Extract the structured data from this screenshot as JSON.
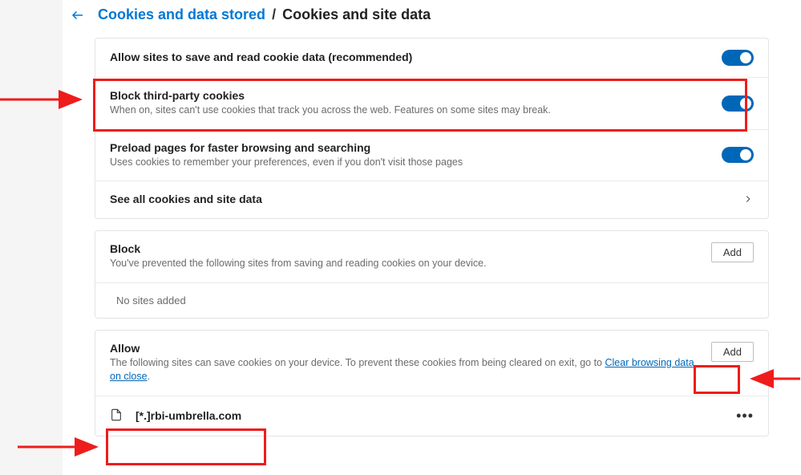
{
  "breadcrumb": {
    "link": "Cookies and data stored",
    "sep": "/",
    "current": "Cookies and site data"
  },
  "settings": {
    "allow_save": {
      "title": "Allow sites to save and read cookie data (recommended)"
    },
    "block_third": {
      "title": "Block third-party cookies",
      "desc": "When on, sites can't use cookies that track you across the web. Features on some sites may break."
    },
    "preload": {
      "title": "Preload pages for faster browsing and searching",
      "desc": "Uses cookies to remember your preferences, even if you don't visit those pages"
    },
    "see_all": {
      "title": "See all cookies and site data"
    }
  },
  "block_section": {
    "title": "Block",
    "desc": "You've prevented the following sites from saving and reading cookies on your device.",
    "add": "Add",
    "empty": "No sites added"
  },
  "allow_section": {
    "title": "Allow",
    "desc_pre": "The following sites can save cookies on your device. To prevent these cookies from being cleared on exit, go to ",
    "desc_link": "Clear browsing data on close",
    "desc_post": ".",
    "add": "Add",
    "site": "[*.]rbi-umbrella.com"
  }
}
